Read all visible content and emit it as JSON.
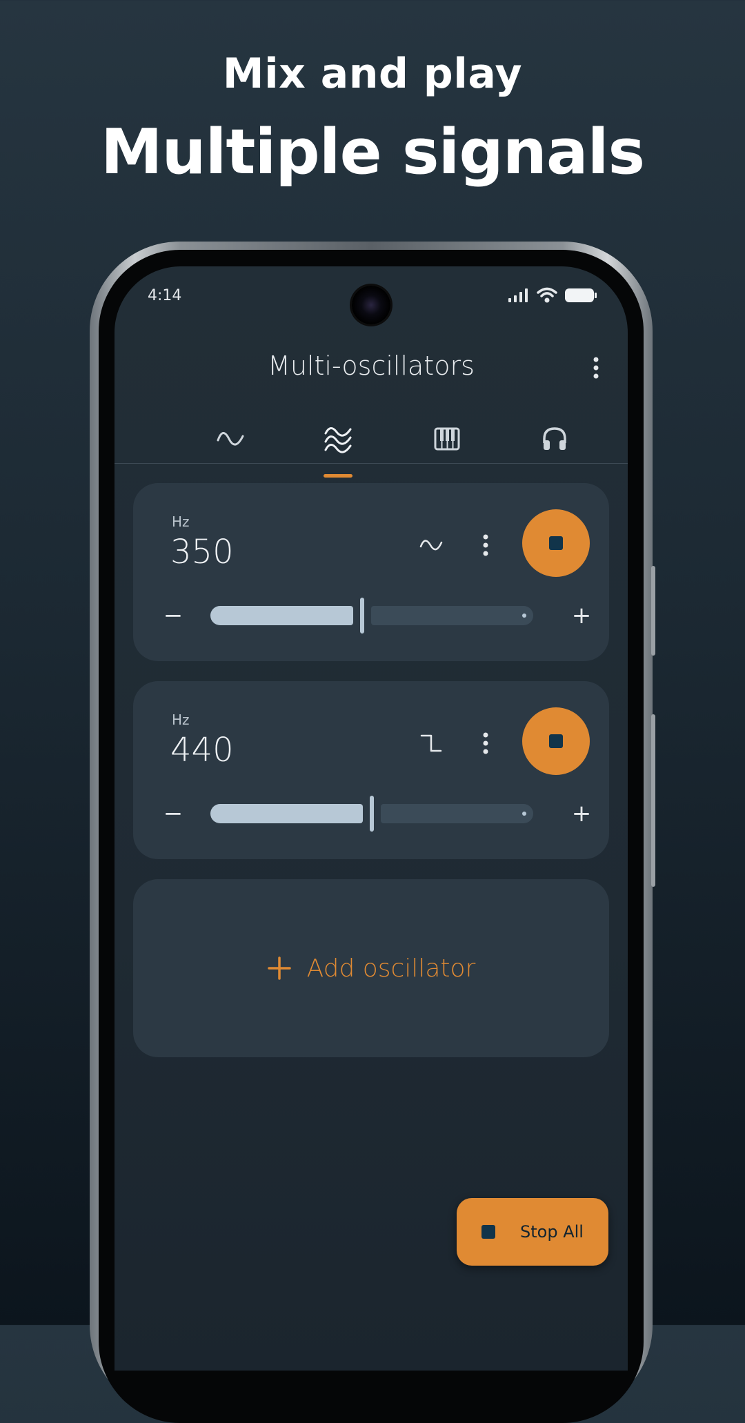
{
  "promo": {
    "headline_top": "Mix and play",
    "headline_main": "Multiple signals"
  },
  "status_bar": {
    "time": "4:14"
  },
  "app_bar": {
    "title": "Multi-oscillators"
  },
  "tabs": [
    {
      "icon": "sine-wave-icon",
      "selected": false
    },
    {
      "icon": "multi-wave-icon",
      "selected": true
    },
    {
      "icon": "piano-keys-icon",
      "selected": false
    },
    {
      "icon": "headphones-icon",
      "selected": false
    }
  ],
  "oscillators": [
    {
      "unit": "Hz",
      "frequency": "350",
      "waveform_icon": "sine-wave-icon",
      "playing": true,
      "slider_fraction": 0.47
    },
    {
      "unit": "Hz",
      "frequency": "440",
      "waveform_icon": "square-wave-icon",
      "playing": true,
      "slider_fraction": 0.5
    }
  ],
  "add_card": {
    "label": "Add oscillator"
  },
  "stop_all": {
    "label": "Stop All"
  },
  "colors": {
    "accent": "#e08a33",
    "card": "#2c3944",
    "background": "#222e37",
    "slider": "#b7c8d6"
  }
}
